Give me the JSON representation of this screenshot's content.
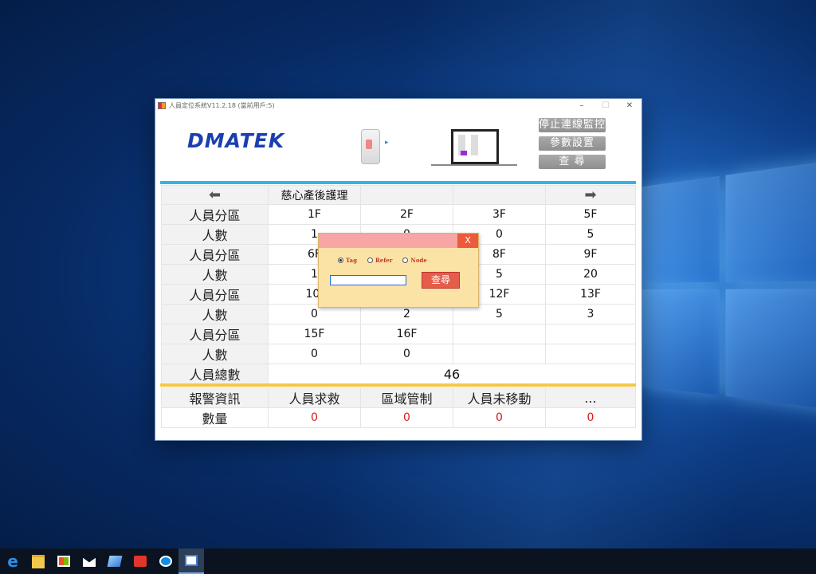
{
  "window": {
    "title": "人員定位系統V11.2.18 (當前用戶:5)",
    "controls": [
      "–",
      "☐",
      "✕"
    ]
  },
  "header": {
    "logo": "DMATEK",
    "buttons": [
      "停止連線監控",
      "參數設置",
      "查 尋"
    ]
  },
  "grid": {
    "ward": "慈心產後護理",
    "rows": [
      {
        "label": "人員分區",
        "cells": [
          "1F",
          "2F",
          "3F",
          "5F"
        ]
      },
      {
        "label": "人數",
        "cells": [
          "1",
          "0",
          "0",
          "5"
        ]
      },
      {
        "label": "人員分區",
        "cells": [
          "6F",
          "",
          "8F",
          "9F"
        ]
      },
      {
        "label": "人數",
        "cells": [
          "1",
          "",
          "5",
          "20"
        ]
      },
      {
        "label": "人員分區",
        "cells": [
          "10I",
          "",
          "12F",
          "13F"
        ]
      },
      {
        "label": "人數",
        "cells": [
          "0",
          "2",
          "5",
          "3"
        ]
      },
      {
        "label": "人員分區",
        "cells": [
          "15F",
          "16F",
          "",
          ""
        ]
      },
      {
        "label": "人數",
        "cells": [
          "0",
          "0",
          "",
          ""
        ]
      }
    ],
    "total_label": "人員總數",
    "total_value": "46"
  },
  "alarm": {
    "headers": [
      "報警資訊",
      "人員求救",
      "區域管制",
      "人員未移動",
      "..."
    ],
    "count_label": "數量",
    "counts": [
      "0",
      "0",
      "0",
      "0"
    ]
  },
  "dialog": {
    "close": "X",
    "radios": [
      "Tag",
      "Refer",
      "Node"
    ],
    "selected": "Tag",
    "input_value": "",
    "search_label": "查尋"
  },
  "colors": {
    "accent_blue": "#35b3e8",
    "accent_yellow": "#f3c84a",
    "alarm_red": "#d61a1a",
    "dialog_bg": "#fbe3a6"
  },
  "taskbar": {
    "icons": [
      "edge-icon",
      "file-explorer-icon",
      "store-icon",
      "mail-icon",
      "app-icon",
      "anydesk-icon",
      "teamviewer-icon",
      "positioning-app-icon"
    ]
  }
}
